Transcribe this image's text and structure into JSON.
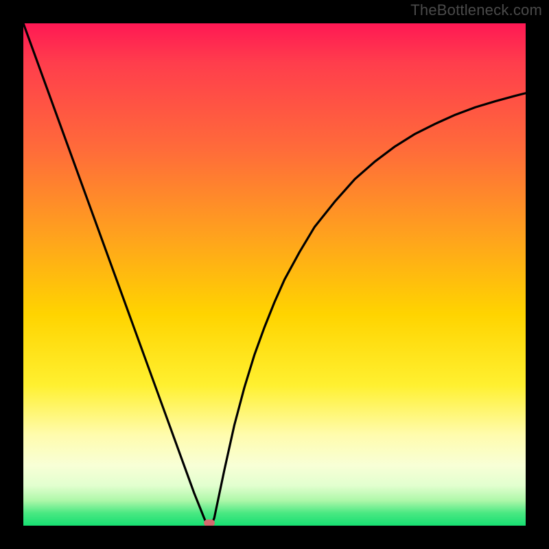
{
  "watermark": "TheBottleneck.com",
  "colors": {
    "frame": "#000000",
    "curve": "#000000",
    "marker": "#d46a6e",
    "gradient_stops": [
      "#ff1854",
      "#ff3e4c",
      "#ff6b3a",
      "#ffa11e",
      "#ffd400",
      "#fff030",
      "#fffcae",
      "#f8ffd6",
      "#e2ffcf",
      "#aef7a9",
      "#49e882",
      "#17df72"
    ]
  },
  "chart_data": {
    "type": "line",
    "title": "",
    "xlabel": "",
    "ylabel": "",
    "xlim": [
      0,
      1
    ],
    "ylim": [
      0,
      1
    ],
    "x": [
      0.0,
      0.02,
      0.04,
      0.06,
      0.08,
      0.1,
      0.12,
      0.14,
      0.16,
      0.18,
      0.2,
      0.22,
      0.24,
      0.26,
      0.28,
      0.3,
      0.32,
      0.34,
      0.36,
      0.365,
      0.37,
      0.375,
      0.38,
      0.4,
      0.42,
      0.44,
      0.46,
      0.48,
      0.5,
      0.52,
      0.55,
      0.58,
      0.62,
      0.66,
      0.7,
      0.74,
      0.78,
      0.82,
      0.86,
      0.9,
      0.94,
      0.98,
      1.0
    ],
    "y": [
      1.0,
      0.945,
      0.89,
      0.835,
      0.78,
      0.725,
      0.67,
      0.615,
      0.56,
      0.505,
      0.45,
      0.395,
      0.34,
      0.285,
      0.23,
      0.175,
      0.12,
      0.065,
      0.015,
      0.003,
      0.0,
      0.003,
      0.015,
      0.11,
      0.2,
      0.275,
      0.34,
      0.395,
      0.445,
      0.49,
      0.545,
      0.595,
      0.645,
      0.69,
      0.725,
      0.755,
      0.78,
      0.8,
      0.818,
      0.833,
      0.845,
      0.856,
      0.861
    ],
    "min_point": {
      "x": 0.37,
      "y": 0.0
    }
  }
}
